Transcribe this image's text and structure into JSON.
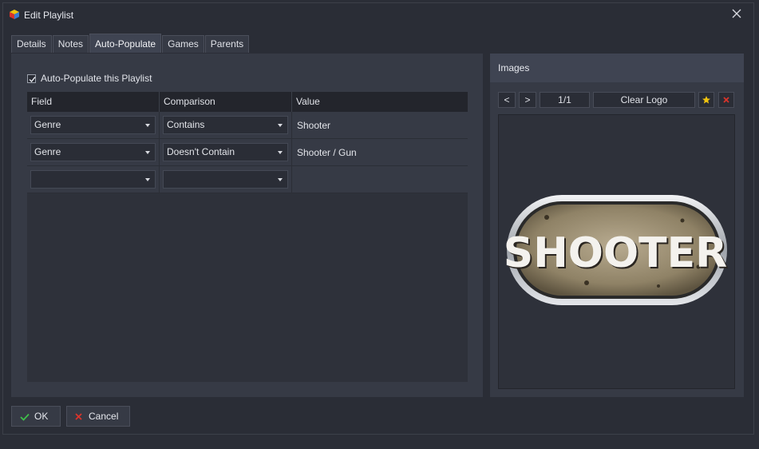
{
  "window": {
    "title": "Edit Playlist"
  },
  "tabs": [
    {
      "label": "Details"
    },
    {
      "label": "Notes"
    },
    {
      "label": "Auto-Populate",
      "active": true
    },
    {
      "label": "Games"
    },
    {
      "label": "Parents"
    }
  ],
  "auto_populate": {
    "checkbox_label": "Auto-Populate this Playlist",
    "checked": true,
    "columns": {
      "field": "Field",
      "comparison": "Comparison",
      "value": "Value"
    },
    "rows": [
      {
        "field": "Genre",
        "comparison": "Contains",
        "value": "Shooter"
      },
      {
        "field": "Genre",
        "comparison": "Doesn't Contain",
        "value": "Shooter / Gun"
      },
      {
        "field": "",
        "comparison": "",
        "value": ""
      }
    ]
  },
  "images": {
    "header": "Images",
    "prev_label": "<",
    "next_label": ">",
    "counter": "1/1",
    "clear_label": "Clear Logo",
    "logo_text": "SHOOTER"
  },
  "buttons": {
    "ok": "OK",
    "cancel": "Cancel"
  },
  "colors": {
    "accent_yellow": "#f1c40f",
    "delete_red": "#d9342b",
    "ok_green": "#3fbf4a"
  }
}
